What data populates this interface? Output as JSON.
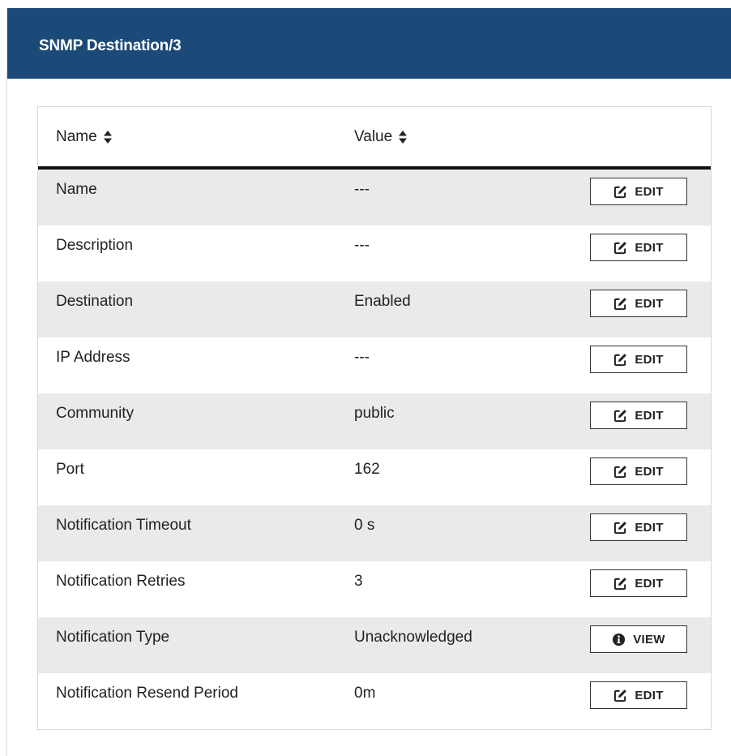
{
  "panel": {
    "title": "SNMP Destination/3"
  },
  "table": {
    "columns": [
      "Name",
      "Value"
    ],
    "rows": [
      {
        "name": "Name",
        "value": "---",
        "action": "EDIT",
        "action_icon": "edit-icon"
      },
      {
        "name": "Description",
        "value": "---",
        "action": "EDIT",
        "action_icon": "edit-icon"
      },
      {
        "name": "Destination",
        "value": "Enabled",
        "action": "EDIT",
        "action_icon": "edit-icon"
      },
      {
        "name": "IP Address",
        "value": "---",
        "action": "EDIT",
        "action_icon": "edit-icon"
      },
      {
        "name": "Community",
        "value": "public",
        "action": "EDIT",
        "action_icon": "edit-icon"
      },
      {
        "name": "Port",
        "value": "162",
        "action": "EDIT",
        "action_icon": "edit-icon"
      },
      {
        "name": "Notification Timeout",
        "value": "0 s",
        "action": "EDIT",
        "action_icon": "edit-icon"
      },
      {
        "name": "Notification Retries",
        "value": "3",
        "action": "EDIT",
        "action_icon": "edit-icon"
      },
      {
        "name": "Notification Type",
        "value": "Unacknowledged",
        "action": "VIEW",
        "action_icon": "info-icon"
      },
      {
        "name": "Notification Resend Period",
        "value": "0m",
        "action": "EDIT",
        "action_icon": "edit-icon"
      }
    ]
  },
  "colors": {
    "header_bg": "#1b4a79",
    "row_alt_bg": "#eaeaea"
  }
}
